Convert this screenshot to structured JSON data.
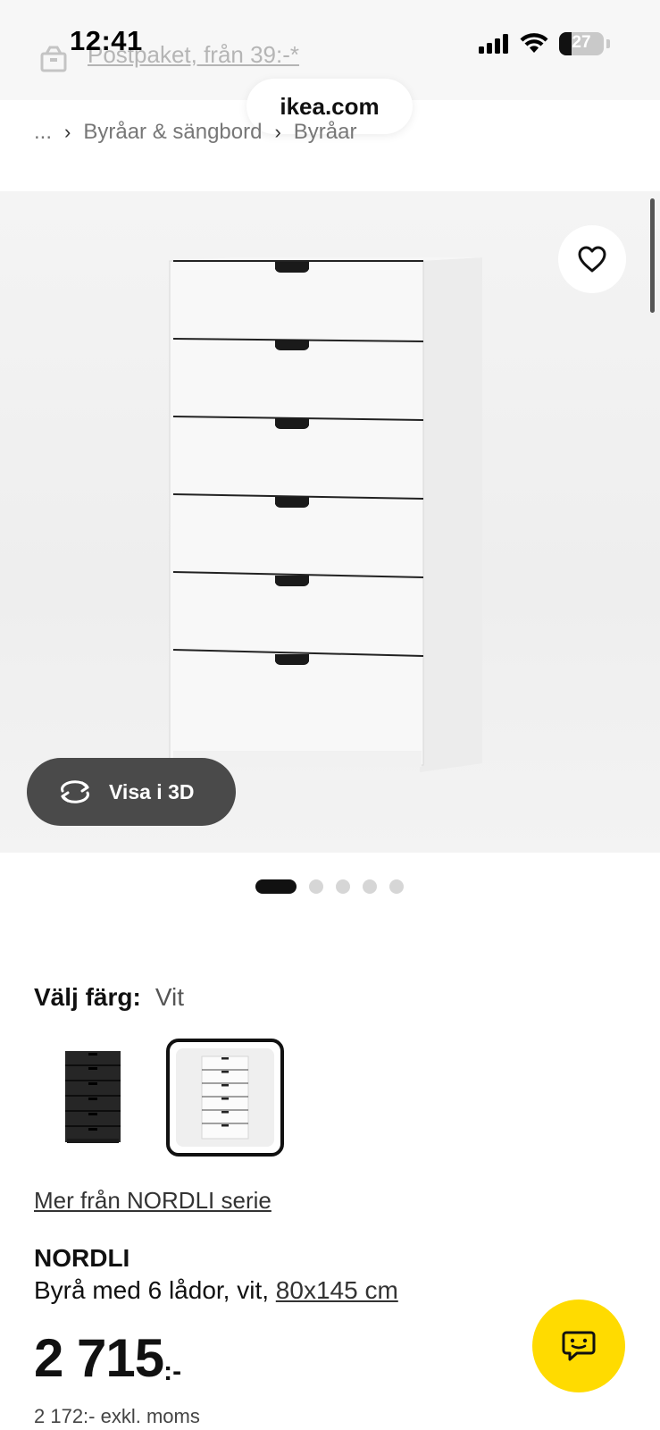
{
  "status_bar": {
    "time": "12:41",
    "battery": "27",
    "battery_level": 0.27
  },
  "promo": {
    "text": "Postpaket, från 39:-*",
    "icon": "package-icon"
  },
  "browser": {
    "url": "ikea.com"
  },
  "breadcrumb": {
    "ellipsis": "...",
    "items": [
      "Byråar & sängbord",
      "Byråar"
    ]
  },
  "gallery": {
    "view3d_label": "Visa i 3D",
    "image_count": 5,
    "active_index": 0,
    "favourite_icon": "heart-icon"
  },
  "color": {
    "label": "Välj färg:",
    "value": "Vit",
    "options": [
      {
        "name": "svart",
        "hex": "#2a2a2a",
        "selected": false
      },
      {
        "name": "vit",
        "hex": "#f5f5f5",
        "selected": true
      }
    ]
  },
  "series_link": "Mer från NORDLI serie",
  "product": {
    "name": "NORDLI",
    "description": "Byrå med 6 lådor, vit, ",
    "size": "80x145 cm"
  },
  "price": {
    "amount": "2 715",
    "suffix": ":-",
    "excl_vat": "2 172:- exkl. moms"
  },
  "chat": {
    "icon": "chat-icon"
  }
}
